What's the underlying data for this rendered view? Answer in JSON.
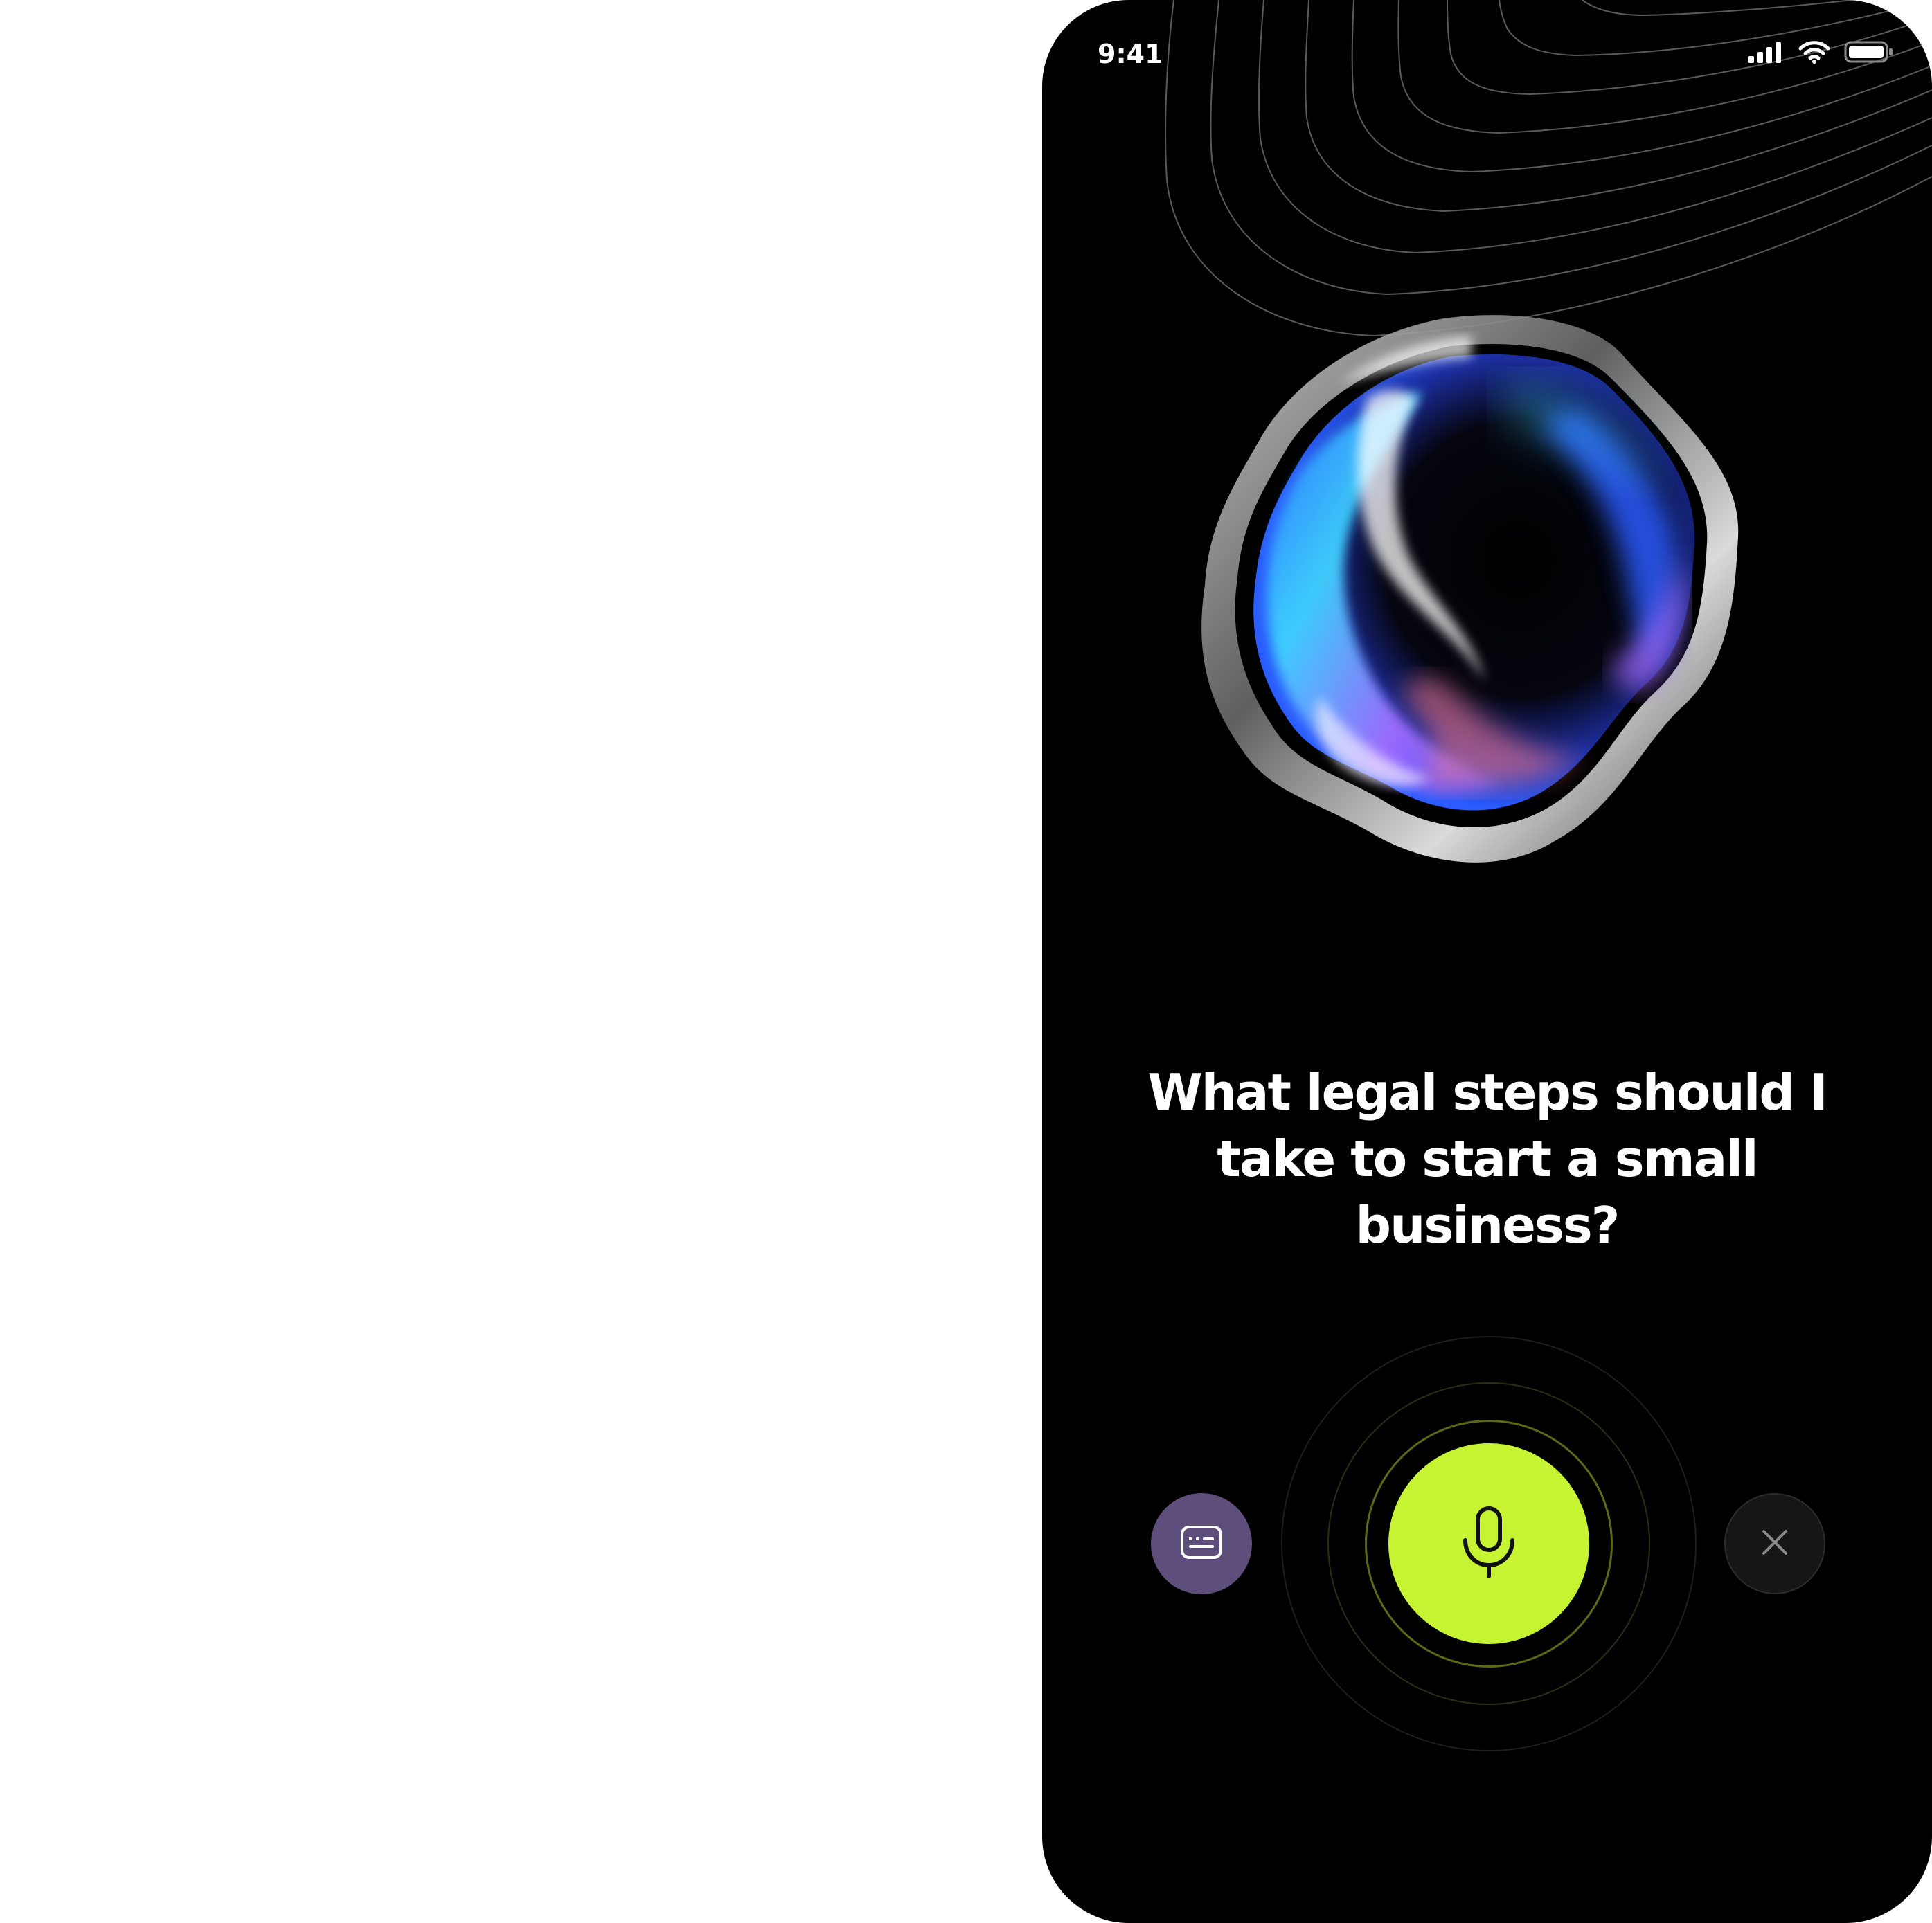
{
  "status_bar": {
    "time": "9:41",
    "icons": [
      "cellular-signal-icon",
      "wifi-icon",
      "battery-icon"
    ]
  },
  "orb": {
    "icon": "ai-orb-visual",
    "colors": [
      "#2a5cff",
      "#3fd3ff",
      "#a26bff",
      "#ff7a8a",
      "#ffffff"
    ]
  },
  "question": {
    "text": "What legal steps should I take to start a small business?"
  },
  "controls": {
    "captions_icon": "captions-icon",
    "mic_icon": "microphone-icon",
    "close_icon": "close-icon"
  },
  "colors": {
    "background": "#000000",
    "mic_accent": "#c6f432",
    "captions_button": "#5d4e7c",
    "close_button": "#161616",
    "text": "#ffffff"
  }
}
